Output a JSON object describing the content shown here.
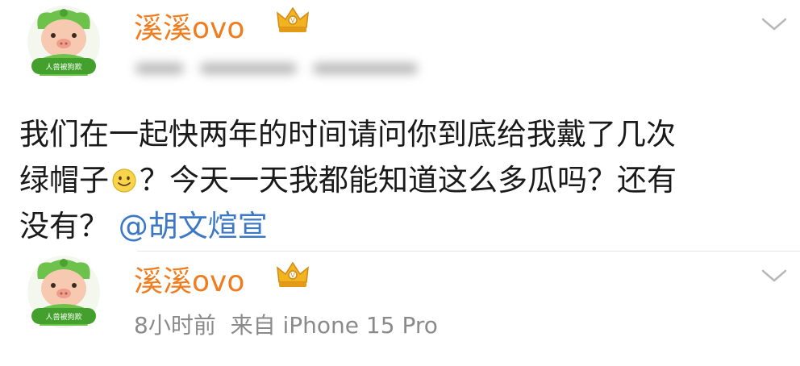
{
  "posts": [
    {
      "username": "溪溪ovo",
      "avatar_badge": "人兽被狗欺",
      "content": {
        "line1": "我们在一起快两年的时间请问你到底给我戴了几次",
        "line2_a": "绿帽子",
        "emoji": "smile-emoji",
        "line2_b": "？今天一天我都能知道这么多瓜吗？还有",
        "line3_a": "没有？",
        "mention": "@胡文煊宣"
      }
    },
    {
      "username": "溪溪ovo",
      "avatar_badge": "人兽被狗欺",
      "meta": "8小时前  来自 iPhone 15 Pro"
    }
  ],
  "colors": {
    "username": "#f07c1e",
    "mention": "#3d78c7",
    "meta": "#8a8a8a"
  }
}
